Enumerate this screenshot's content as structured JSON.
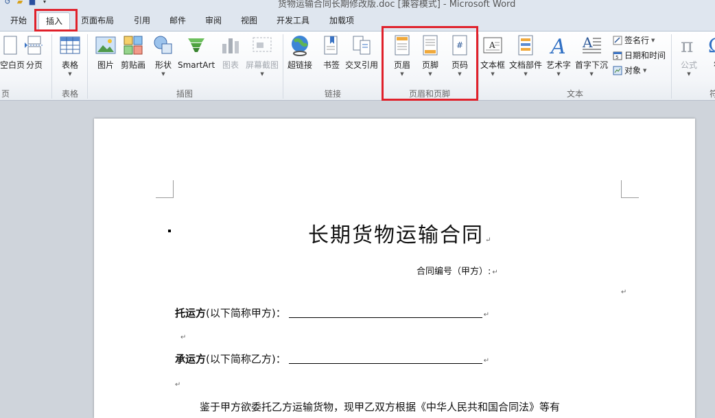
{
  "title_bar": {
    "title": "货物运输合同长期修改版.doc [兼容模式] - Microsoft Word"
  },
  "tabs": [
    {
      "label": "开始"
    },
    {
      "label": "插入",
      "active": true
    },
    {
      "label": "页面布局"
    },
    {
      "label": "引用"
    },
    {
      "label": "邮件"
    },
    {
      "label": "审阅"
    },
    {
      "label": "视图"
    },
    {
      "label": "开发工具"
    },
    {
      "label": "加载项"
    }
  ],
  "ribbon": {
    "pages_group": {
      "label": "页",
      "blank_page": "空白页",
      "page_break": "分页"
    },
    "tables_group": {
      "label": "表格",
      "table": "表格"
    },
    "illustrations_group": {
      "label": "插图",
      "picture": "图片",
      "clip_art": "剪贴画",
      "shapes": "形状",
      "smartart": "SmartArt",
      "chart": "图表",
      "screenshot": "屏幕截图"
    },
    "links_group": {
      "label": "链接",
      "hyperlink": "超链接",
      "bookmark": "书签",
      "cross_reference": "交叉引用"
    },
    "header_footer_group": {
      "label": "页眉和页脚",
      "header": "页眉",
      "footer": "页脚",
      "page_number": "页码"
    },
    "text_group": {
      "label": "文本",
      "text_box": "文本框",
      "quick_parts": "文档部件",
      "wordart": "艺术字",
      "drop_cap": "首字下沉",
      "signature_line": "签名行",
      "date_time": "日期和时间",
      "object": "对象"
    },
    "symbols_group": {
      "label": "符",
      "equation": "公式",
      "symbol": "符"
    }
  },
  "document": {
    "title": "长期货物运输合同",
    "contract_number": "合同编号（甲方）:",
    "shipper_bold": "托运方",
    "shipper_rest": "(以下简称甲方)：",
    "carrier_bold": "承运方",
    "carrier_rest": "(以下简称乙方)：",
    "body_text": "鉴于甲方欲委托乙方运输货物，现甲乙双方根据《中华人民共和国合同法》等有",
    "paragraph_mark": "↵"
  },
  "colors": {
    "highlight": "#e0202a",
    "ribbon_bg": "#f4f6f9",
    "workspace_bg": "#cfd4db"
  }
}
